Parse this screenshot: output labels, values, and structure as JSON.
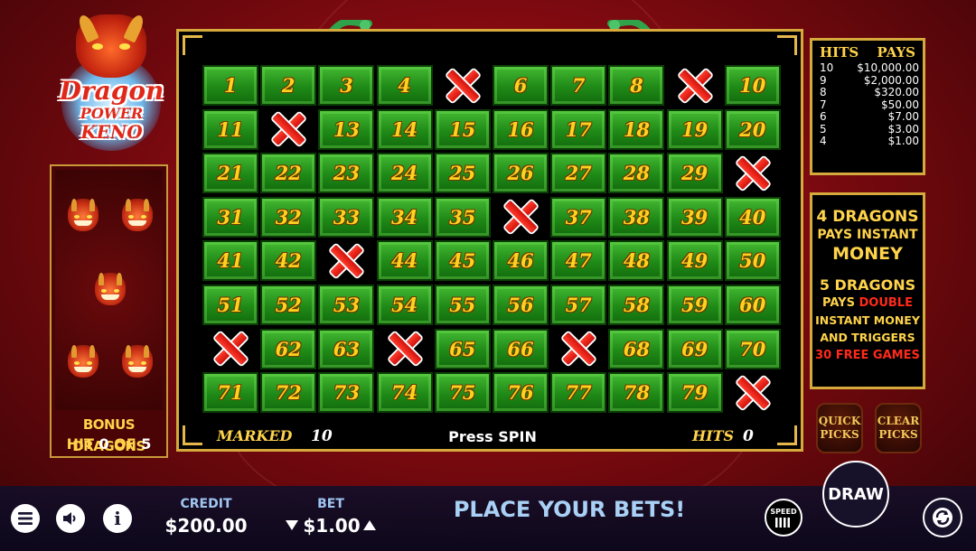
{
  "game": {
    "logo": {
      "word1": "Dragon",
      "word2": "POWER",
      "word3": "KENO"
    },
    "bonus": {
      "title": "BONUS DRAGONS",
      "hit_label": "HIT",
      "hit_count": "0",
      "of_label": "OF",
      "total": "5"
    },
    "board": {
      "cells": [
        {
          "n": "1",
          "m": false
        },
        {
          "n": "2",
          "m": false
        },
        {
          "n": "3",
          "m": false
        },
        {
          "n": "4",
          "m": false
        },
        {
          "n": "5",
          "m": true
        },
        {
          "n": "6",
          "m": false
        },
        {
          "n": "7",
          "m": false
        },
        {
          "n": "8",
          "m": false
        },
        {
          "n": "9",
          "m": true
        },
        {
          "n": "10",
          "m": false
        },
        {
          "n": "11",
          "m": false
        },
        {
          "n": "12",
          "m": true
        },
        {
          "n": "13",
          "m": false
        },
        {
          "n": "14",
          "m": false
        },
        {
          "n": "15",
          "m": false
        },
        {
          "n": "16",
          "m": false
        },
        {
          "n": "17",
          "m": false
        },
        {
          "n": "18",
          "m": false
        },
        {
          "n": "19",
          "m": false
        },
        {
          "n": "20",
          "m": false
        },
        {
          "n": "21",
          "m": false
        },
        {
          "n": "22",
          "m": false
        },
        {
          "n": "23",
          "m": false
        },
        {
          "n": "24",
          "m": false
        },
        {
          "n": "25",
          "m": false
        },
        {
          "n": "26",
          "m": false
        },
        {
          "n": "27",
          "m": false
        },
        {
          "n": "28",
          "m": false
        },
        {
          "n": "29",
          "m": false
        },
        {
          "n": "30",
          "m": true
        },
        {
          "n": "31",
          "m": false
        },
        {
          "n": "32",
          "m": false
        },
        {
          "n": "33",
          "m": false
        },
        {
          "n": "34",
          "m": false
        },
        {
          "n": "35",
          "m": false
        },
        {
          "n": "36",
          "m": true
        },
        {
          "n": "37",
          "m": false
        },
        {
          "n": "38",
          "m": false
        },
        {
          "n": "39",
          "m": false
        },
        {
          "n": "40",
          "m": false
        },
        {
          "n": "41",
          "m": false
        },
        {
          "n": "42",
          "m": false
        },
        {
          "n": "43",
          "m": true
        },
        {
          "n": "44",
          "m": false
        },
        {
          "n": "45",
          "m": false
        },
        {
          "n": "46",
          "m": false
        },
        {
          "n": "47",
          "m": false
        },
        {
          "n": "48",
          "m": false
        },
        {
          "n": "49",
          "m": false
        },
        {
          "n": "50",
          "m": false
        },
        {
          "n": "51",
          "m": false
        },
        {
          "n": "52",
          "m": false
        },
        {
          "n": "53",
          "m": false
        },
        {
          "n": "54",
          "m": false
        },
        {
          "n": "55",
          "m": false
        },
        {
          "n": "56",
          "m": false
        },
        {
          "n": "57",
          "m": false
        },
        {
          "n": "58",
          "m": false
        },
        {
          "n": "59",
          "m": false
        },
        {
          "n": "60",
          "m": false
        },
        {
          "n": "61",
          "m": true
        },
        {
          "n": "62",
          "m": false
        },
        {
          "n": "63",
          "m": false
        },
        {
          "n": "64",
          "m": true
        },
        {
          "n": "65",
          "m": false
        },
        {
          "n": "66",
          "m": false
        },
        {
          "n": "67",
          "m": true
        },
        {
          "n": "68",
          "m": false
        },
        {
          "n": "69",
          "m": false
        },
        {
          "n": "70",
          "m": false
        },
        {
          "n": "71",
          "m": false
        },
        {
          "n": "72",
          "m": false
        },
        {
          "n": "73",
          "m": false
        },
        {
          "n": "74",
          "m": false
        },
        {
          "n": "75",
          "m": false
        },
        {
          "n": "76",
          "m": false
        },
        {
          "n": "77",
          "m": false
        },
        {
          "n": "78",
          "m": false
        },
        {
          "n": "79",
          "m": false
        },
        {
          "n": "80",
          "m": true
        }
      ],
      "marked_label": "MARKED",
      "marked_count": "10",
      "status": "Press SPIN",
      "hits_label": "HITS",
      "hits_count": "0"
    },
    "paytable": {
      "hits_header": "HITS",
      "pays_header": "PAYS",
      "rows": [
        {
          "hits": "10",
          "pays": "$10,000.00"
        },
        {
          "hits": "9",
          "pays": "$2,000.00"
        },
        {
          "hits": "8",
          "pays": "$320.00"
        },
        {
          "hits": "7",
          "pays": "$50.00"
        },
        {
          "hits": "6",
          "pays": "$7.00"
        },
        {
          "hits": "5",
          "pays": "$3.00"
        },
        {
          "hits": "4",
          "pays": "$1.00"
        }
      ]
    },
    "promo": {
      "line1": "4 DRAGONS",
      "line2": "PAYS INSTANT",
      "line3": "MONEY",
      "line4": "5 DRAGONS",
      "line5a": "PAYS",
      "line5b": "DOUBLE",
      "line6": "INSTANT MONEY",
      "line7": "AND TRIGGERS",
      "line8": "30 FREE GAMES"
    },
    "quick_picks": {
      "line1": "QUICK",
      "line2": "PICKS"
    },
    "clear_picks": {
      "line1": "CLEAR",
      "line2": "PICKS"
    }
  },
  "bottom_bar": {
    "credit_label": "CREDIT",
    "credit_value": "$200.00",
    "bet_label": "BET",
    "bet_value": "$1.00",
    "message": "PLACE YOUR BETS!",
    "speed_label": "SPEED",
    "draw_label": "DRAW"
  },
  "colors": {
    "gold": "#d6a93c",
    "cell_green": "#1f8a17",
    "x_red": "#e0180e",
    "bg_red": "#9e1017",
    "message_blue": "#a9d0f5"
  }
}
